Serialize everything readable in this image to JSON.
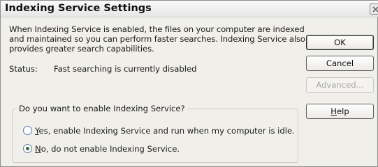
{
  "window": {
    "title": "Indexing Service Settings",
    "close_icon": "close-icon"
  },
  "description": "When Indexing Service is enabled, the files on your computer are indexed and maintained so you can perform faster searches. Indexing Service also provides greater search capabilities.",
  "status": {
    "label": "Status:",
    "value": "Fast searching is currently disabled"
  },
  "buttons": {
    "ok": "OK",
    "cancel": "Cancel",
    "advanced": "Advanced...",
    "help_accel": "H",
    "help_rest": "elp"
  },
  "group": {
    "title": "Do you want to enable Indexing Service?",
    "options": [
      {
        "accel": "Y",
        "rest": "es, enable Indexing Service and run when my computer is idle.",
        "selected": false
      },
      {
        "accel": "N",
        "rest": "o, do not enable Indexing Service.",
        "selected": true
      }
    ]
  },
  "colors": {
    "dialog_bg": "#f0efea",
    "radio_selected_dot": "#2d6e2d",
    "radio_border": "#5b7ea8",
    "disabled_text": "#a6a6a6"
  }
}
